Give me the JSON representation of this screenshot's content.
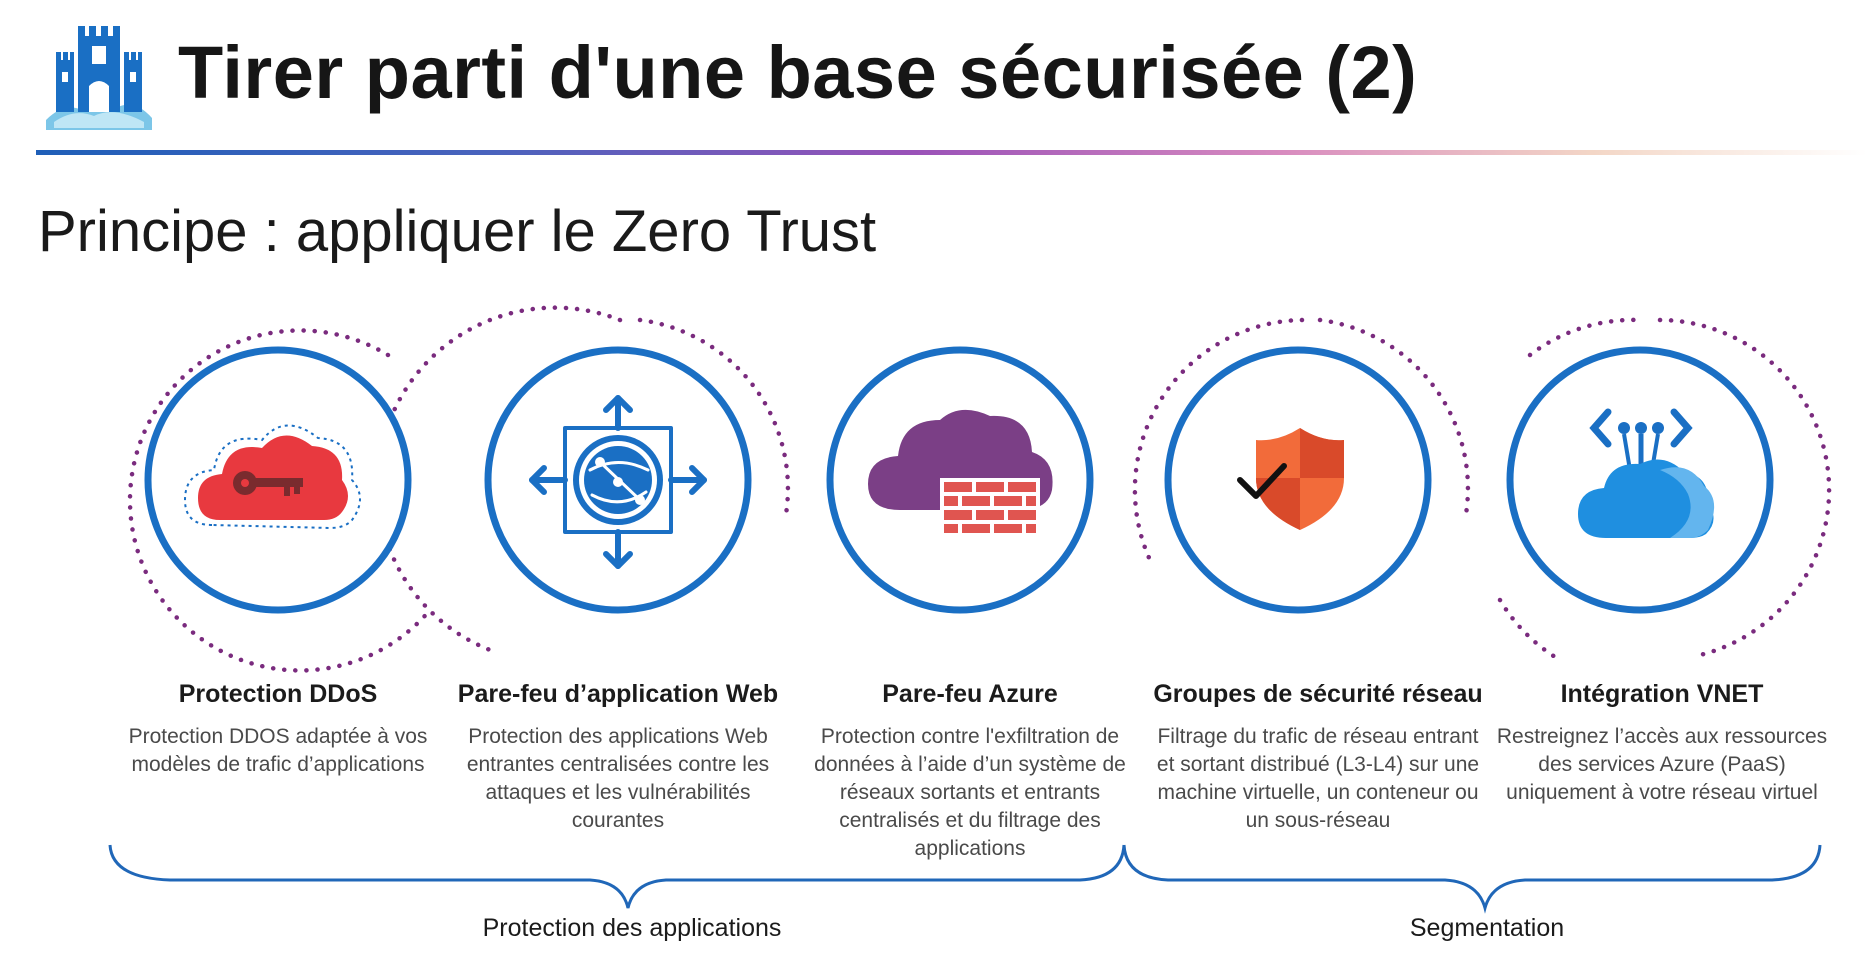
{
  "header": {
    "title": "Tirer parti d'une base sécurisée (2)",
    "logo_icon": "castle-icon",
    "rule_colors": [
      "#1f5fb8",
      "#9a52b8",
      "#f3d6c6"
    ]
  },
  "subtitle": "Principe : appliquer le Zero Trust",
  "features": [
    {
      "title": "Protection DDoS",
      "description": "Protection DDOS adaptée à vos modèles de trafic d’applications",
      "icon": "cloud-key-icon"
    },
    {
      "title": "Pare-feu d’application Web",
      "description": "Protection des applications Web entrantes centralisées contre les attaques et les vulnérabilités courantes",
      "icon": "web-app-firewall-icon"
    },
    {
      "title": "Pare-feu Azure",
      "description": "Protection contre l'exfiltration de données à l’aide d’un système de réseaux sortants et entrants centralisés et du filtrage des applications",
      "icon": "cloud-firewall-icon"
    },
    {
      "title": "Groupes de sécurité réseau",
      "description": "Filtrage du trafic de réseau entrant et sortant distribué (L3-L4) sur une machine virtuelle, un conteneur ou un sous-réseau",
      "icon": "shield-check-icon"
    },
    {
      "title": "Intégration VNET",
      "description": "Restreignez l’accès aux ressources des services Azure (PaaS) uniquement à votre réseau virtuel",
      "icon": "vnet-cloud-icon"
    }
  ],
  "groups": [
    {
      "label": "Protection des applications"
    },
    {
      "label": "Segmentation"
    }
  ],
  "colors": {
    "ring": "#1a6fc4",
    "dots": "#7a2b7e",
    "brace": "#2067b8",
    "ddos_red": "#e8393f",
    "azure_purple": "#7b3f86",
    "brick_red": "#e05550",
    "shield_orange": "#f26b3a",
    "vnet_blue": "#1f8fe0"
  }
}
